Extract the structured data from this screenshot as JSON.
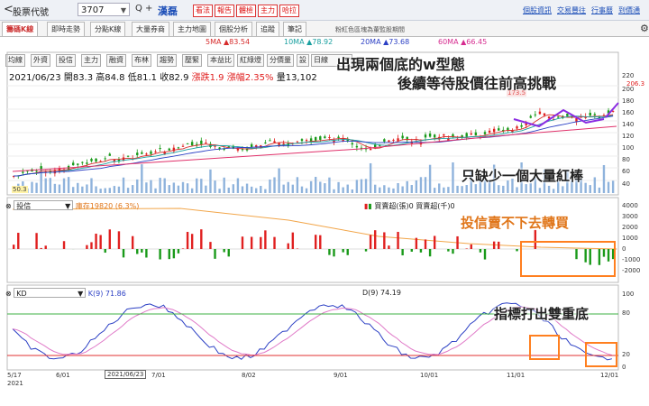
{
  "topbar": {
    "back_glyph": "<",
    "title": "股票代號",
    "code": "3707",
    "search_plus": "Q +",
    "stock_name": "漢磊",
    "buttons": [
      "看法",
      "報告",
      "體檢",
      "主力",
      "哈拉"
    ],
    "links": [
      "個股資訊",
      "交易豐往",
      "行事曆",
      "到價通"
    ]
  },
  "tabs": {
    "items": [
      "籌碼K線",
      "即時走勢",
      "分點K線",
      "大量券商",
      "主力地圖",
      "個股分析",
      "追蹤",
      "筆記"
    ],
    "note": "粉紅色區塊為董監股期間"
  },
  "ma_legend": [
    {
      "label": "5MA",
      "value": "▲83.54",
      "color": "#d62b2b"
    },
    {
      "label": "10MA",
      "value": "▲78.92",
      "color": "#1aa0a0"
    },
    {
      "label": "20MA",
      "value": "▲73.68",
      "color": "#2b3fc4"
    },
    {
      "label": "60MA",
      "value": "▲66.45",
      "color": "#d62b8f"
    }
  ],
  "toolbar": [
    "均線",
    "外資",
    "投信",
    "主力",
    "融資",
    "布林",
    "趨勢",
    "壓緊",
    "本益比",
    "紅綠燈",
    "分價量",
    "設",
    "日線"
  ],
  "quote": {
    "date": "2021/06/23",
    "open_label": "開",
    "open": "83.3",
    "high_label": "高",
    "high": "84.8",
    "low_label": "低",
    "low": "81.1",
    "close_label": "收",
    "close": "82.9",
    "change_label": "漲跌",
    "change": "1.9",
    "pct_label": "漲幅",
    "pct": "2.35%",
    "vol_label": "量",
    "vol": "13,102"
  },
  "annotations": {
    "title_line1": "出現兩個底的w型態",
    "title_line2": "後續等待股價往前高挑戰",
    "volume_note": "只缺少一個大量紅棒",
    "trust_note": "投信賣不下去轉買",
    "kd_note": "指標打出雙重底"
  },
  "price_axis": {
    "ticks": [
      "220",
      "200",
      "180",
      "160",
      "140",
      "120",
      "100",
      "80",
      "60",
      "40"
    ],
    "current": "206.3",
    "peak": "173.5",
    "low": "50.3"
  },
  "trust_panel": {
    "name": "投信",
    "inventory_label": "庫存19820 (6.3%)",
    "net_label": "買賣超(張)0 買賣超(千)0",
    "ticks": [
      "4000",
      "3000",
      "2000",
      "1000",
      "0",
      "-1000",
      "-2000"
    ]
  },
  "kd_panel": {
    "name": "KD",
    "k_label": "K(9) 71.86",
    "d_label": "D(9) 74.19",
    "ticks": [
      "100",
      "80",
      "20",
      "0"
    ]
  },
  "date_axis": {
    "labels": [
      "5/17",
      "6/01",
      "7/01",
      "8/02",
      "9/01",
      "10/01",
      "11/01",
      "12/01"
    ],
    "year": "2021",
    "cursor": "2021/06/23"
  },
  "colors": {
    "up": "#e02020",
    "down": "#1a9a1a",
    "volume": "#8fb3dc",
    "link": "#1d4fb8",
    "highlight": "#ff7f1f"
  }
}
